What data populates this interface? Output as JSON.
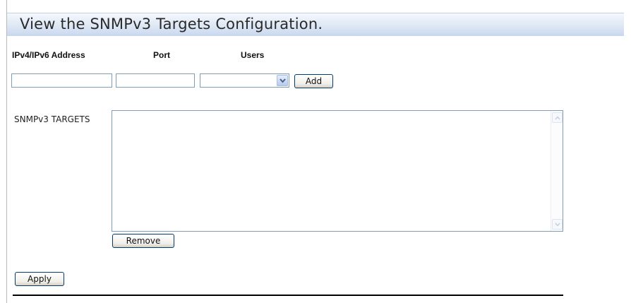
{
  "header": {
    "title": "View the SNMPv3 Targets Configuration."
  },
  "form": {
    "col_address": "IPv4/IPv6 Address",
    "col_port": "Port",
    "col_users": "Users",
    "address_value": "",
    "port_value": "",
    "users_selected": "",
    "add_label": "Add"
  },
  "targets": {
    "label": "SNMPv3 TARGETS",
    "items": [],
    "remove_label": "Remove"
  },
  "footer": {
    "apply_label": "Apply"
  },
  "icons": {
    "dropdown": "chevron-down-icon",
    "scroll_up": "scroll-up-icon",
    "scroll_down": "scroll-down-icon"
  },
  "colors": {
    "header_gradient_top": "#f5f8fd",
    "header_gradient_bottom": "#c9d8ef",
    "input_border": "#7f9db9",
    "button_border": "#003c74"
  }
}
